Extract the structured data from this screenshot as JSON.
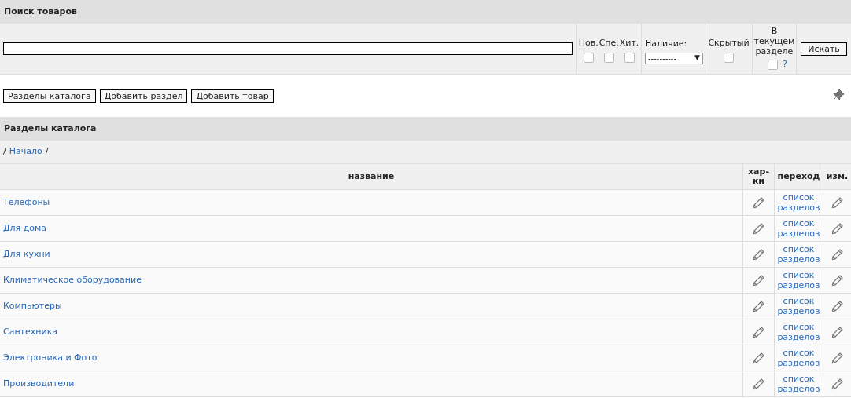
{
  "search_panel": {
    "title": "Поиск товаров",
    "flags": [
      {
        "label": "Нов.",
        "checked": false
      },
      {
        "label": "Спе.",
        "checked": false
      },
      {
        "label": "Хит.",
        "checked": false
      }
    ],
    "availability": {
      "label": "Наличие:",
      "value": "----------",
      "arrow": "▼"
    },
    "hidden": {
      "label": "Скрытый",
      "checked": false
    },
    "current_section": {
      "label_lines": [
        "В",
        "текущем",
        "разделе"
      ],
      "checked": false,
      "help": "?"
    },
    "search_button": "Искать"
  },
  "toolbar": {
    "buttons": [
      "Разделы каталога",
      "Добавить раздел",
      "Добавить товар"
    ]
  },
  "catalog": {
    "title": "Разделы каталога",
    "breadcrumb": {
      "sep_before": "/",
      "link": "Начало",
      "sep_after": "/"
    },
    "columns": [
      {
        "lines": [
          "название"
        ]
      },
      {
        "lines": [
          "хар-",
          "ки"
        ]
      },
      {
        "lines": [
          "переход"
        ]
      },
      {
        "lines": [
          "изм."
        ]
      }
    ],
    "rows": [
      {
        "name": "Телефоны",
        "link_lines": [
          "список",
          "разделов"
        ]
      },
      {
        "name": "Для дома",
        "link_lines": [
          "список",
          "разделов"
        ]
      },
      {
        "name": "Для кухни",
        "link_lines": [
          "список",
          "разделов"
        ]
      },
      {
        "name": "Климатическое оборудование",
        "link_lines": [
          "список",
          "разделов"
        ]
      },
      {
        "name": "Компьютеры",
        "link_lines": [
          "список",
          "разделов"
        ]
      },
      {
        "name": "Сантехника",
        "link_lines": [
          "список",
          "разделов"
        ]
      },
      {
        "name": "Электроника и Фото",
        "link_lines": [
          "список",
          "разделов"
        ]
      },
      {
        "name": "Производители",
        "link_lines": [
          "список",
          "разделов"
        ]
      }
    ]
  }
}
